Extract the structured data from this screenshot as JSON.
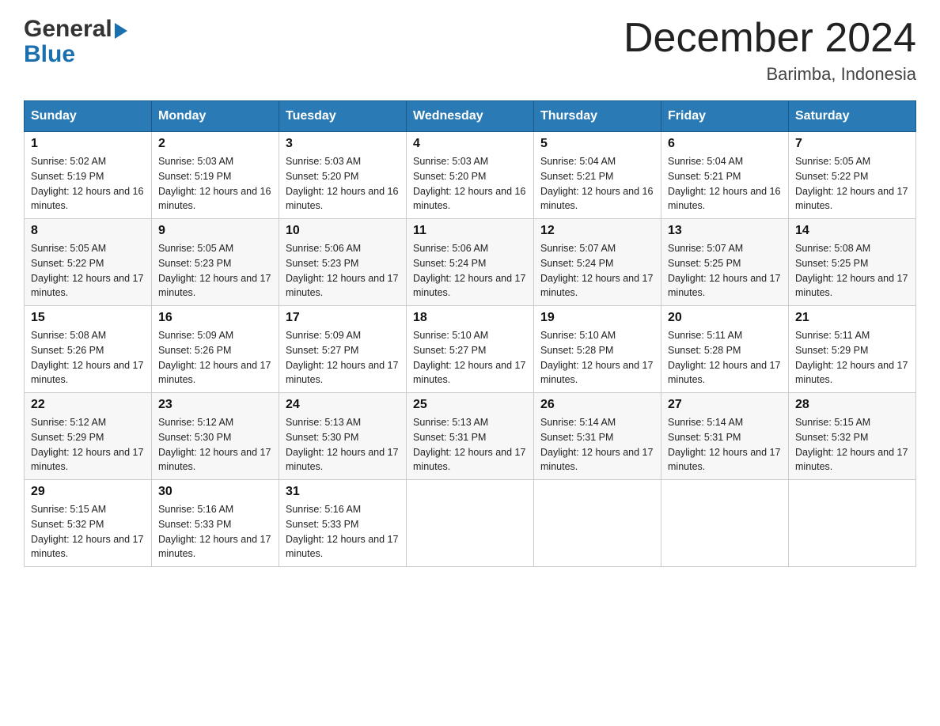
{
  "header": {
    "logo_line1": "General",
    "logo_line2": "Blue",
    "month_title": "December 2024",
    "location": "Barimba, Indonesia"
  },
  "days_of_week": [
    "Sunday",
    "Monday",
    "Tuesday",
    "Wednesday",
    "Thursday",
    "Friday",
    "Saturday"
  ],
  "weeks": [
    [
      {
        "day": "1",
        "sunrise": "5:02 AM",
        "sunset": "5:19 PM",
        "daylight": "12 hours and 16 minutes."
      },
      {
        "day": "2",
        "sunrise": "5:03 AM",
        "sunset": "5:19 PM",
        "daylight": "12 hours and 16 minutes."
      },
      {
        "day": "3",
        "sunrise": "5:03 AM",
        "sunset": "5:20 PM",
        "daylight": "12 hours and 16 minutes."
      },
      {
        "day": "4",
        "sunrise": "5:03 AM",
        "sunset": "5:20 PM",
        "daylight": "12 hours and 16 minutes."
      },
      {
        "day": "5",
        "sunrise": "5:04 AM",
        "sunset": "5:21 PM",
        "daylight": "12 hours and 16 minutes."
      },
      {
        "day": "6",
        "sunrise": "5:04 AM",
        "sunset": "5:21 PM",
        "daylight": "12 hours and 16 minutes."
      },
      {
        "day": "7",
        "sunrise": "5:05 AM",
        "sunset": "5:22 PM",
        "daylight": "12 hours and 17 minutes."
      }
    ],
    [
      {
        "day": "8",
        "sunrise": "5:05 AM",
        "sunset": "5:22 PM",
        "daylight": "12 hours and 17 minutes."
      },
      {
        "day": "9",
        "sunrise": "5:05 AM",
        "sunset": "5:23 PM",
        "daylight": "12 hours and 17 minutes."
      },
      {
        "day": "10",
        "sunrise": "5:06 AM",
        "sunset": "5:23 PM",
        "daylight": "12 hours and 17 minutes."
      },
      {
        "day": "11",
        "sunrise": "5:06 AM",
        "sunset": "5:24 PM",
        "daylight": "12 hours and 17 minutes."
      },
      {
        "day": "12",
        "sunrise": "5:07 AM",
        "sunset": "5:24 PM",
        "daylight": "12 hours and 17 minutes."
      },
      {
        "day": "13",
        "sunrise": "5:07 AM",
        "sunset": "5:25 PM",
        "daylight": "12 hours and 17 minutes."
      },
      {
        "day": "14",
        "sunrise": "5:08 AM",
        "sunset": "5:25 PM",
        "daylight": "12 hours and 17 minutes."
      }
    ],
    [
      {
        "day": "15",
        "sunrise": "5:08 AM",
        "sunset": "5:26 PM",
        "daylight": "12 hours and 17 minutes."
      },
      {
        "day": "16",
        "sunrise": "5:09 AM",
        "sunset": "5:26 PM",
        "daylight": "12 hours and 17 minutes."
      },
      {
        "day": "17",
        "sunrise": "5:09 AM",
        "sunset": "5:27 PM",
        "daylight": "12 hours and 17 minutes."
      },
      {
        "day": "18",
        "sunrise": "5:10 AM",
        "sunset": "5:27 PM",
        "daylight": "12 hours and 17 minutes."
      },
      {
        "day": "19",
        "sunrise": "5:10 AM",
        "sunset": "5:28 PM",
        "daylight": "12 hours and 17 minutes."
      },
      {
        "day": "20",
        "sunrise": "5:11 AM",
        "sunset": "5:28 PM",
        "daylight": "12 hours and 17 minutes."
      },
      {
        "day": "21",
        "sunrise": "5:11 AM",
        "sunset": "5:29 PM",
        "daylight": "12 hours and 17 minutes."
      }
    ],
    [
      {
        "day": "22",
        "sunrise": "5:12 AM",
        "sunset": "5:29 PM",
        "daylight": "12 hours and 17 minutes."
      },
      {
        "day": "23",
        "sunrise": "5:12 AM",
        "sunset": "5:30 PM",
        "daylight": "12 hours and 17 minutes."
      },
      {
        "day": "24",
        "sunrise": "5:13 AM",
        "sunset": "5:30 PM",
        "daylight": "12 hours and 17 minutes."
      },
      {
        "day": "25",
        "sunrise": "5:13 AM",
        "sunset": "5:31 PM",
        "daylight": "12 hours and 17 minutes."
      },
      {
        "day": "26",
        "sunrise": "5:14 AM",
        "sunset": "5:31 PM",
        "daylight": "12 hours and 17 minutes."
      },
      {
        "day": "27",
        "sunrise": "5:14 AM",
        "sunset": "5:31 PM",
        "daylight": "12 hours and 17 minutes."
      },
      {
        "day": "28",
        "sunrise": "5:15 AM",
        "sunset": "5:32 PM",
        "daylight": "12 hours and 17 minutes."
      }
    ],
    [
      {
        "day": "29",
        "sunrise": "5:15 AM",
        "sunset": "5:32 PM",
        "daylight": "12 hours and 17 minutes."
      },
      {
        "day": "30",
        "sunrise": "5:16 AM",
        "sunset": "5:33 PM",
        "daylight": "12 hours and 17 minutes."
      },
      {
        "day": "31",
        "sunrise": "5:16 AM",
        "sunset": "5:33 PM",
        "daylight": "12 hours and 17 minutes."
      },
      null,
      null,
      null,
      null
    ]
  ],
  "labels": {
    "sunrise_prefix": "Sunrise: ",
    "sunset_prefix": "Sunset: ",
    "daylight_prefix": "Daylight: "
  }
}
